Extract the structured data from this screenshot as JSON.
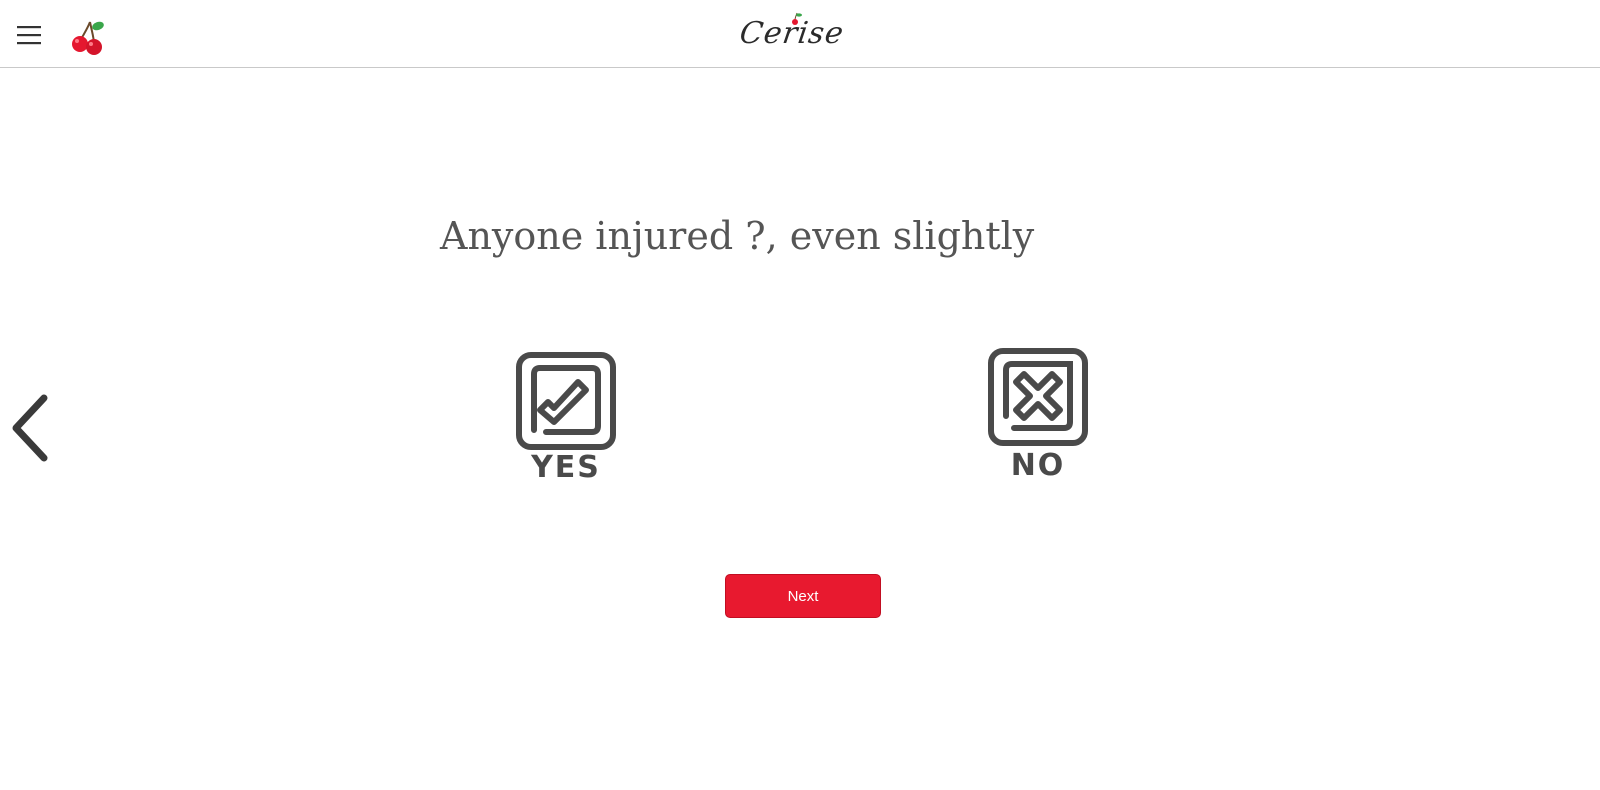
{
  "header": {
    "menu_icon": "hamburger-menu-icon",
    "logo_icon": "cherry-icon",
    "brand": "Cerise"
  },
  "question": {
    "text": "Anyone injured ?, even slightly"
  },
  "navigation": {
    "back_icon": "chevron-left-icon"
  },
  "options": [
    {
      "label": "YES",
      "icon": "checkbox-checked-icon"
    },
    {
      "label": "NO",
      "icon": "checkbox-x-icon"
    }
  ],
  "actions": {
    "next_label": "Next"
  },
  "colors": {
    "accent": "#e8192f",
    "icon_gray": "#4a4a4a",
    "question_text": "#555555"
  }
}
